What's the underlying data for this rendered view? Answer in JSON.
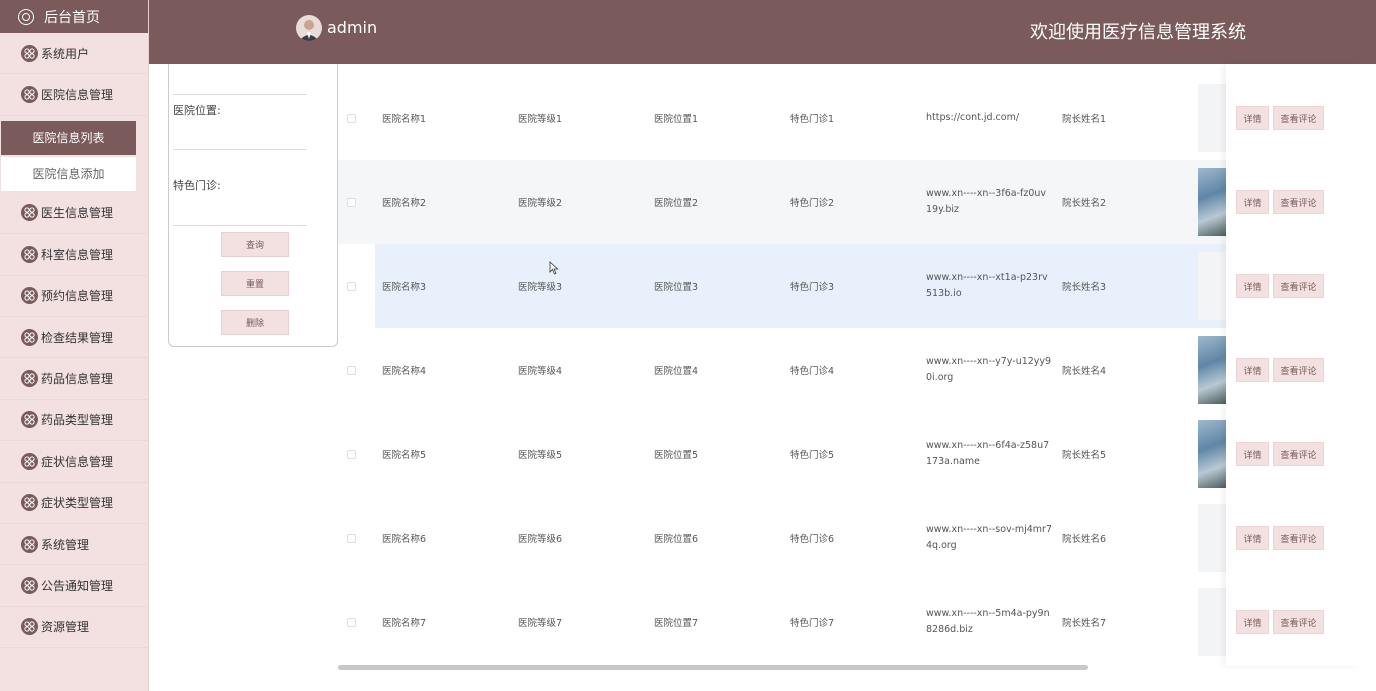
{
  "sidebar": {
    "home": "后台首页",
    "items": [
      {
        "label": "系统用户"
      },
      {
        "label": "医院信息管理"
      }
    ],
    "sub_active": "医院信息列表",
    "sub_item": "医院信息添加",
    "items_after": [
      {
        "label": "医生信息管理"
      },
      {
        "label": "科室信息管理"
      },
      {
        "label": "预约信息管理"
      },
      {
        "label": "检查结果管理"
      },
      {
        "label": "药品信息管理"
      },
      {
        "label": "药品类型管理"
      },
      {
        "label": "症状信息管理"
      },
      {
        "label": "症状类型管理"
      },
      {
        "label": "系统管理"
      },
      {
        "label": "公告通知管理"
      },
      {
        "label": "资源管理"
      }
    ]
  },
  "header": {
    "username": "admin",
    "title": "欢迎使用医疗信息管理系统"
  },
  "search": {
    "label_location": "医院位置:",
    "label_clinic": "特色门诊:",
    "btn_query": "查询",
    "btn_reset": "重置",
    "btn_delete": "删除"
  },
  "table": {
    "rows": [
      {
        "name": "医院名称1",
        "level": "医院等级1",
        "location": "医院位置1",
        "clinic": "特色门诊1",
        "url": "https://cont.jd.com/",
        "dean": "院长姓名1",
        "has_image": false
      },
      {
        "name": "医院名称2",
        "level": "医院等级2",
        "location": "医院位置2",
        "clinic": "特色门诊2",
        "url": "www.xn----xn--3f6a-fz0uv19y.biz",
        "dean": "院长姓名2",
        "has_image": true
      },
      {
        "name": "医院名称3",
        "level": "医院等级3",
        "location": "医院位置3",
        "clinic": "特色门诊3",
        "url": "www.xn----xn--xt1a-p23rv513b.io",
        "dean": "院长姓名3",
        "has_image": false
      },
      {
        "name": "医院名称4",
        "level": "医院等级4",
        "location": "医院位置4",
        "clinic": "特色门诊4",
        "url": "www.xn----xn--y7y-u12yy90i.org",
        "dean": "院长姓名4",
        "has_image": true
      },
      {
        "name": "医院名称5",
        "level": "医院等级5",
        "location": "医院位置5",
        "clinic": "特色门诊5",
        "url": "www.xn----xn--6f4a-z58u7173a.name",
        "dean": "院长姓名5",
        "has_image": true
      },
      {
        "name": "医院名称6",
        "level": "医院等级6",
        "location": "医院位置6",
        "clinic": "特色门诊6",
        "url": "www.xn----xn--sov-mj4mr74q.org",
        "dean": "院长姓名6",
        "has_image": false
      },
      {
        "name": "医院名称7",
        "level": "医院等级7",
        "location": "医院位置7",
        "clinic": "特色门诊7",
        "url": "www.xn----xn--5m4a-py9n8286d.biz",
        "dean": "院长姓名7",
        "has_image": false
      }
    ],
    "btn_detail": "详情",
    "btn_comments": "查看评论"
  },
  "pager": {
    "text": ""
  },
  "colors": {
    "brand": "#7a5a5a",
    "sidebar_bg": "#f3e0e0",
    "row_hover": "#e8f1fb"
  }
}
